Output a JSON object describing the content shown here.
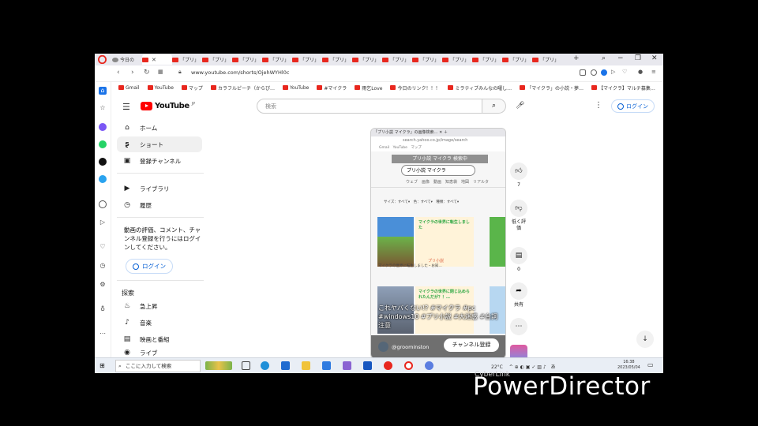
{
  "browser": {
    "tabs": [
      {
        "label": "今日の",
        "active": false
      },
      {
        "label": "",
        "active": true
      },
      {
        "label": "「プリ」"
      },
      {
        "label": "「プリ」"
      },
      {
        "label": "「プリ」"
      },
      {
        "label": "「プリ」"
      },
      {
        "label": "「プリ」"
      },
      {
        "label": "「プリ」"
      },
      {
        "label": "「プリ」"
      },
      {
        "label": "「プリ」"
      },
      {
        "label": "「プリ」"
      },
      {
        "label": "「プリ」"
      },
      {
        "label": "「プリ」"
      },
      {
        "label": "「プリ」"
      },
      {
        "label": "「プリ」"
      }
    ],
    "new_tab": "+",
    "url": "www.youtube.com/shorts/OjehWYHl0c",
    "bookmarks": [
      "Gmail",
      "YouTube",
      "マップ",
      "カラフルピーチ（からぴ…",
      "YouTube",
      "#マイクラ",
      "雨乞Love",
      "今日のリンク！！！",
      "ミラティブみんなの曜し…",
      "「マイクラ」の小説・夢…",
      "【マイクラ】マルチ募集…"
    ],
    "accent_color": "#ff0000"
  },
  "youtube": {
    "logo_text": "YouTube",
    "logo_sup": "JP",
    "search_placeholder": "検索",
    "login_label": "ログイン",
    "nav": [
      {
        "label": "ホーム",
        "icon": "home-icon"
      },
      {
        "label": "ショート",
        "icon": "shorts-icon"
      },
      {
        "label": "登録チャンネル",
        "icon": "subscriptions-icon"
      },
      {
        "label": "ライブラリ",
        "icon": "library-icon"
      },
      {
        "label": "履歴",
        "icon": "history-icon"
      }
    ],
    "signin_message": "動画の評価、コメント、チャンネル登録を行うにはログインしてください。",
    "explore_heading": "探索",
    "explore": [
      {
        "label": "急上昇",
        "icon": "trending-icon"
      },
      {
        "label": "音楽",
        "icon": "music-icon"
      },
      {
        "label": "映画と番組",
        "icon": "movies-icon"
      },
      {
        "label": "ライブ",
        "icon": "live-icon"
      }
    ]
  },
  "short": {
    "embedded_search_text": "プリ小説 マイクラ",
    "overlay_text": "プリ小説 マイクラ 検索中",
    "embedded_tabs": "ウェブ　画像　動画　知恵袋　地図　リアルタ",
    "filters": "サイズ：すべて▾　色：すべて▾　種類：すべて▾",
    "card1_text": "マイクラの世界に転生しました",
    "card2_text": "マイクラの世界に閉じ込められたんだが？！…",
    "badge": "プリ小説",
    "caption": "マイクラの世界に転生しました・お知…",
    "title": "これヤバくない!? #マイクラ #pc #windows10 #プリ小説 #大迷惑 #台詞注意",
    "channel": "@groominston",
    "subscribe": "チャンネル登録"
  },
  "actions": {
    "like_count": "7",
    "dislike_label": "低く評価",
    "comment_count": "0",
    "share_label": "共有"
  },
  "taskbar": {
    "search_placeholder": "ここに入力して検索",
    "temperature": "22°C",
    "ime": "あ",
    "time": "16:38",
    "date": "2023/05/04"
  },
  "watermark": {
    "small": "CyberLink",
    "big": "PowerDirector"
  }
}
